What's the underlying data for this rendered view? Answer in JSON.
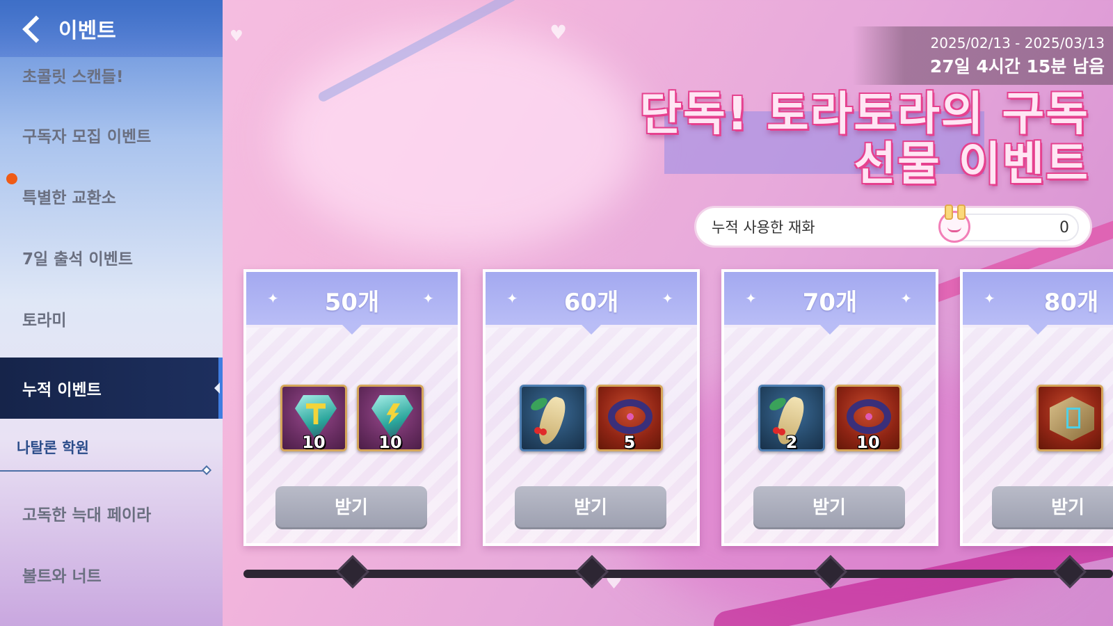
{
  "sidebar": {
    "back_label": "이벤트",
    "items": [
      {
        "label": "초콜릿 스캔들!"
      },
      {
        "label": "구독자 모집 이벤트"
      },
      {
        "label": "특별한 교환소"
      },
      {
        "label": "7일 출석 이벤트"
      },
      {
        "label": "토라미"
      },
      {
        "label": "누적 이벤트"
      },
      {
        "label": "고독한 늑대 페이라"
      },
      {
        "label": "볼트와 너트"
      }
    ],
    "section_label": "나탈론 학원",
    "active_item": "누적 이벤트"
  },
  "event": {
    "date_range": "2025/02/13 - 2025/03/13",
    "time_left": "27일 4시간 15분 남음",
    "title_line1": "단독! 토라토라의 구독",
    "title_line2": "선물 이벤트",
    "currency_label": "누적 사용한 재화",
    "currency_value": "0",
    "currency_icon": "bunny-icon"
  },
  "rewards": [
    {
      "count": "50개",
      "items": [
        {
          "icon": "gem-hammer-icon",
          "qty": "10"
        },
        {
          "icon": "gem-bolt-icon",
          "qty": "10"
        }
      ],
      "button": "받기"
    },
    {
      "count": "60개",
      "items": [
        {
          "icon": "ginseng-icon",
          "qty": ""
        },
        {
          "icon": "necklace-icon",
          "qty": "5"
        }
      ],
      "button": "받기"
    },
    {
      "count": "70개",
      "items": [
        {
          "icon": "ginseng-icon",
          "qty": "2"
        },
        {
          "icon": "necklace-icon",
          "qty": "10"
        }
      ],
      "button": "받기"
    },
    {
      "count": "80개",
      "items": [
        {
          "icon": "cube-box-icon",
          "qty": ""
        }
      ],
      "button": "받기"
    }
  ],
  "colors": {
    "accent": "#3f7de0",
    "title_pink": "#e6418f",
    "notification": "#ef5b16",
    "card_header": "#a3a9f0"
  }
}
